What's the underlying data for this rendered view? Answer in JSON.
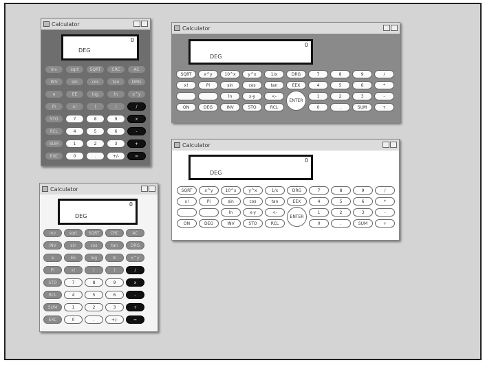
{
  "window_title": "Calculator",
  "display": {
    "value": "0",
    "mode": "DEG"
  },
  "tall_keys": [
    [
      "inv",
      "sqrt",
      "SQRT",
      "CRC",
      "AC"
    ],
    [
      "INV",
      "sin",
      "cos",
      "tan",
      "DRG"
    ],
    [
      "e",
      "EE",
      "log",
      "ln",
      "x^y"
    ],
    [
      "Pi",
      "x!",
      "(",
      ")",
      "/"
    ],
    [
      "STO",
      "7",
      "8",
      "9",
      "x"
    ],
    [
      "RCL",
      "4",
      "5",
      "6",
      "-"
    ],
    [
      "SUM",
      "1",
      "2",
      "3",
      "+"
    ],
    [
      "EXC",
      "0",
      ".",
      "+/-",
      "="
    ]
  ],
  "wide_keys": [
    [
      "SQRT",
      "x^y",
      "10^x",
      "y^x",
      "1/x",
      "DRG",
      "7",
      "8",
      "9",
      "/"
    ],
    [
      "x!",
      "Pi",
      "sin",
      "cos",
      "tan",
      "EEX",
      "4",
      "5",
      "6",
      "*"
    ],
    [
      "",
      "",
      "ln",
      "x-y",
      "<-",
      "",
      "1",
      "2",
      "3",
      "-"
    ],
    [
      "ON",
      "DEG",
      "INV",
      "STO",
      "RCL",
      "",
      "0",
      ".",
      "SUM",
      "+"
    ]
  ],
  "enter_label": "ENTER"
}
